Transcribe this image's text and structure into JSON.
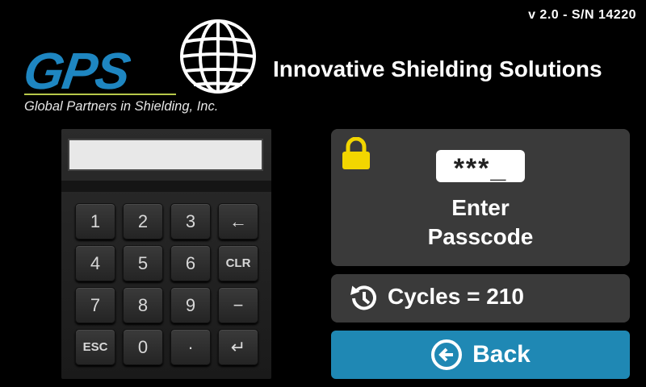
{
  "header": {
    "version": "v 2.0 -  S/N  14220",
    "tagline": "Innovative Shielding Solutions"
  },
  "logo": {
    "text": "GPS",
    "subtitle": "Global Partners in Shielding, Inc.",
    "color": "#1e86c1"
  },
  "keypad": {
    "display_value": "",
    "keys": [
      "1",
      "2",
      "3",
      "←",
      "4",
      "5",
      "6",
      "CLR",
      "7",
      "8",
      "9",
      "−",
      "ESC",
      "0",
      "·",
      "↵"
    ]
  },
  "passcode": {
    "masked_value": "***_",
    "label_line1": "Enter",
    "label_line2": "Passcode",
    "lock_icon": "lock-icon"
  },
  "cycles": {
    "label": "Cycles  = 210",
    "icon": "history-icon"
  },
  "back_button": {
    "label": "Back",
    "color": "#1f88b4"
  }
}
